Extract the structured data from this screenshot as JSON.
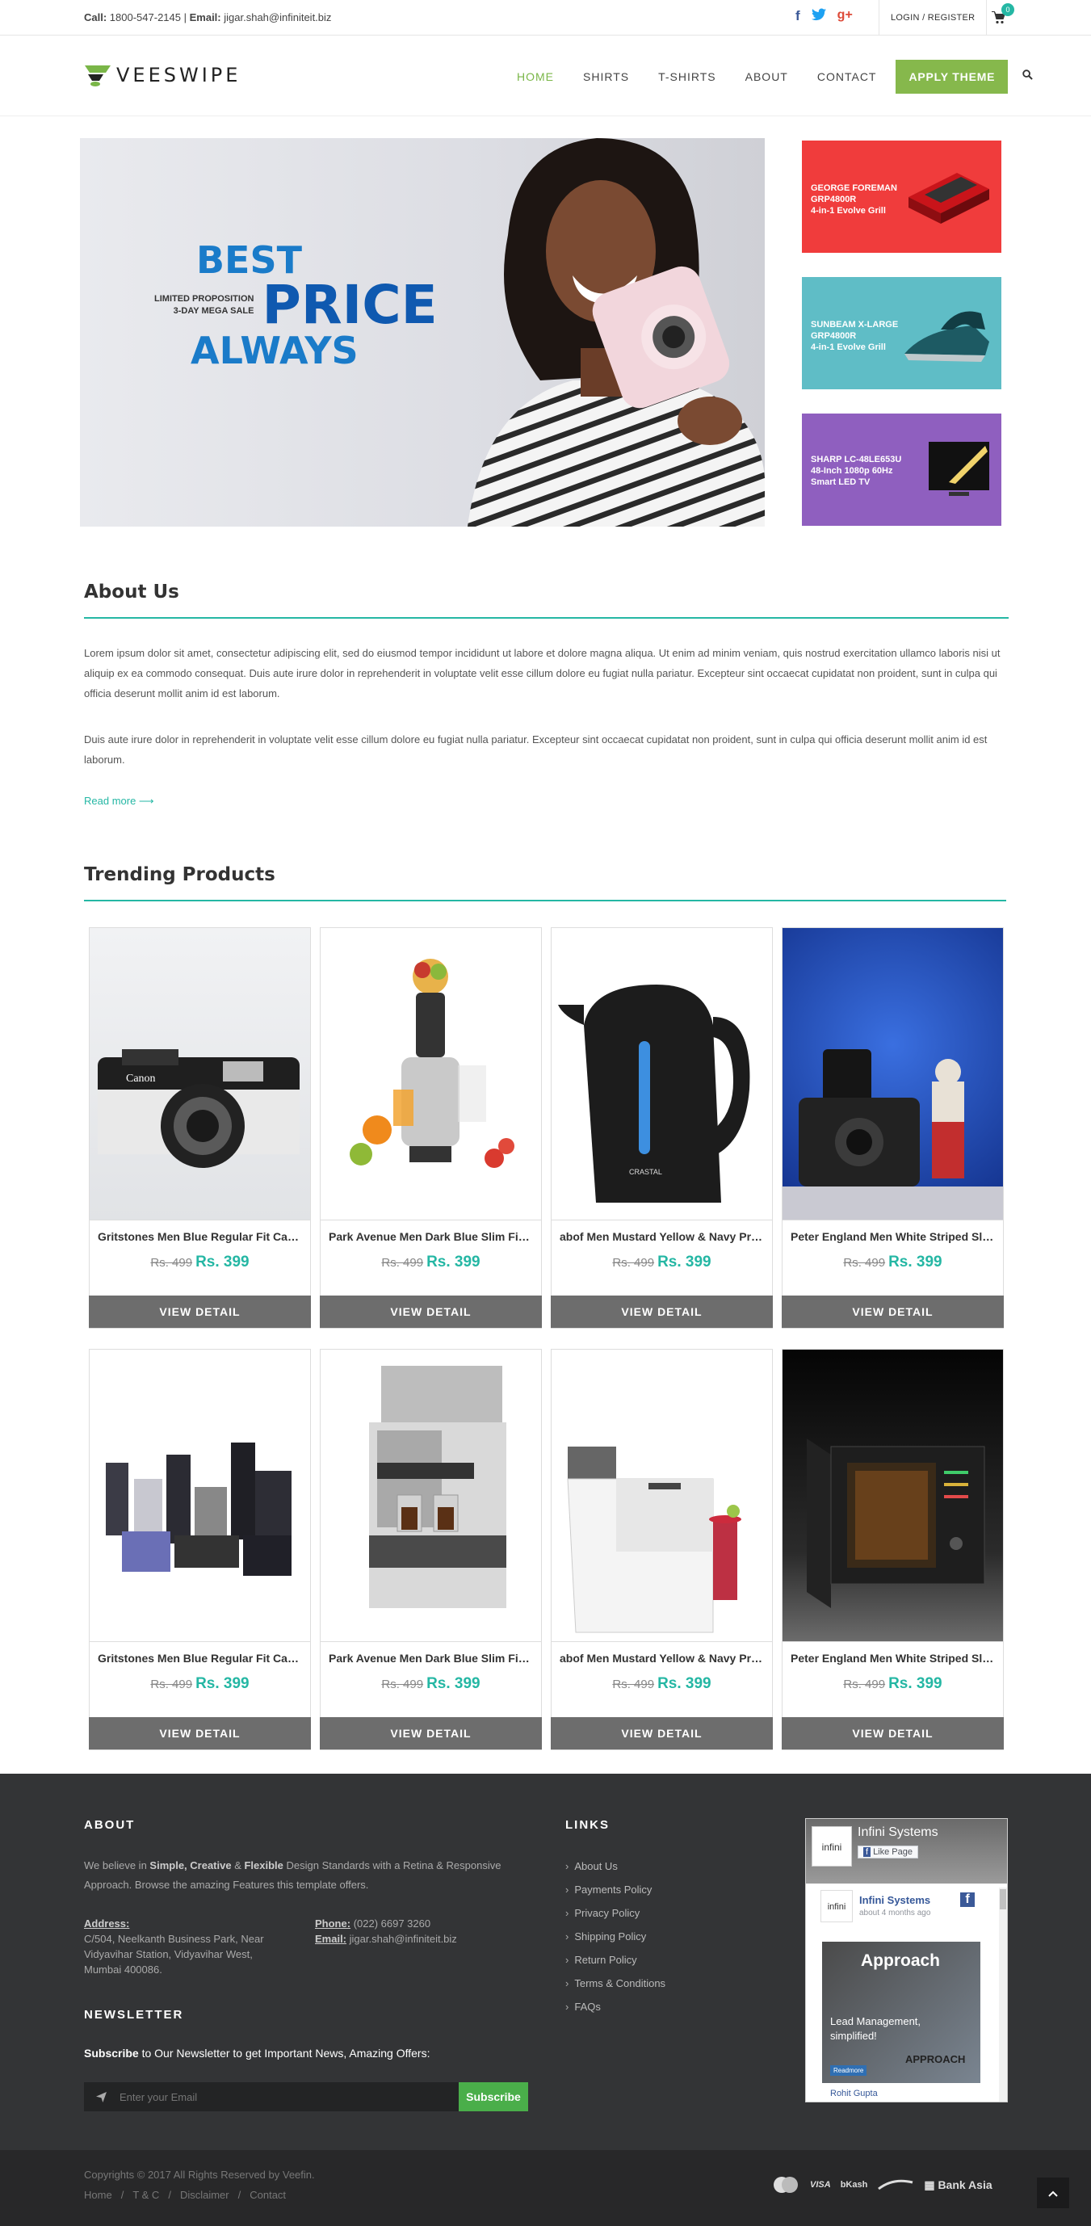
{
  "topbar": {
    "call_label": "Call:",
    "phone": "1800-547-2145",
    "email_label": "Email:",
    "email": "jigar.shah@infiniteit.biz",
    "login": "LOGIN / REGISTER",
    "cart_count": "0"
  },
  "brand": {
    "name": "VEESWIPE"
  },
  "nav": {
    "items": [
      "HOME",
      "SHIRTS",
      "T-SHIRTS",
      "ABOUT",
      "CONTACT"
    ],
    "apply_theme": "APPLY THEME"
  },
  "hero": {
    "line1": "BEST",
    "small1": "LIMITED PROPOSITION",
    "small2": "3-DAY MEGA SALE",
    "line2": "PRICE",
    "line3": "ALWAYS"
  },
  "promos": [
    {
      "l1": "GEORGE FOREMAN",
      "l2": "GRP4800R",
      "l3": "4-in-1 Evolve Grill",
      "color": "#f03c3c"
    },
    {
      "l1": "SUNBEAM X-LARGE",
      "l2": "GRP4800R",
      "l3": "4-in-1 Evolve Grill",
      "color": "#5fbdc6"
    },
    {
      "l1": "SHARP LC-48LE653U",
      "l2": "48-Inch 1080p 60Hz",
      "l3": "Smart LED TV",
      "color": "#8f5fbf"
    }
  ],
  "about": {
    "title": "About Us",
    "p1": "Lorem ipsum dolor sit amet, consectetur adipiscing elit, sed do eiusmod tempor incididunt ut labore et dolore magna aliqua. Ut enim ad minim veniam, quis nostrud exercitation ullamco laboris nisi ut aliquip ex ea commodo consequat. Duis aute irure dolor in reprehenderit in voluptate velit esse cillum dolore eu fugiat nulla pariatur. Excepteur sint occaecat cupidatat non proident, sunt in culpa qui officia deserunt mollit anim id est laborum.",
    "p2": "Duis aute irure dolor in reprehenderit in voluptate velit esse cillum dolore eu fugiat nulla pariatur. Excepteur sint occaecat cupidatat non proident, sunt in culpa qui officia deserunt mollit anim id est laborum.",
    "read_more": "Read more ⟶"
  },
  "trending": {
    "title": "Trending Products",
    "view_label": "VIEW DETAIL",
    "products": [
      {
        "name": "Gritstones Men Blue Regular Fit Casual Shirt",
        "old": "Rs. 499",
        "new": "Rs. 399"
      },
      {
        "name": "Park Avenue Men Dark Blue Slim Fit Formal",
        "old": "Rs. 499",
        "new": "Rs. 399"
      },
      {
        "name": "abof Men Mustard Yellow & Navy Printed",
        "old": "Rs. 499",
        "new": "Rs. 399"
      },
      {
        "name": "Peter England Men White Striped Slim Fit",
        "old": "Rs. 499",
        "new": "Rs. 399"
      },
      {
        "name": "Gritstones Men Blue Regular Fit Casual Shirt",
        "old": "Rs. 499",
        "new": "Rs. 399"
      },
      {
        "name": "Park Avenue Men Dark Blue Slim Fit Formal",
        "old": "Rs. 499",
        "new": "Rs. 399"
      },
      {
        "name": "abof Men Mustard Yellow & Navy Printed",
        "old": "Rs. 499",
        "new": "Rs. 399"
      },
      {
        "name": "Peter England Men White Striped Slim Fit",
        "old": "Rs. 499",
        "new": "Rs. 399"
      }
    ]
  },
  "footer": {
    "about_title": "ABOUT",
    "about_a": "We believe in ",
    "about_b": "Simple, Creative",
    "about_c": " & ",
    "about_d": "Flexible",
    "about_e": " Design Standards with a Retina & Responsive Approach. Browse the amazing Features this template offers.",
    "address_label": "Address:",
    "address": "C/504, Neelkanth Business Park, Near Vidyavihar Station, Vidyavihar West, Mumbai 400086.",
    "phone_label": "Phone:",
    "phone": "(022) 6697 3260",
    "email_label": "Email:",
    "email": "jigar.shah@infiniteit.biz",
    "newsletter_title": "NEWSLETTER",
    "newsletter_bold": "Subscribe",
    "newsletter_rest": " to Our Newsletter to get Important News, Amazing Offers:",
    "newsletter_placeholder": "Enter your Email",
    "subscribe": "Subscribe",
    "links_title": "LINKS",
    "links": [
      "About Us",
      "Payments Policy",
      "Privacy Policy",
      "Shipping Policy",
      "Return Policy",
      "Terms & Conditions",
      "FAQs"
    ],
    "fb": {
      "page_name": "Infini Systems",
      "like": "Like Page",
      "post_name": "Infini Systems",
      "post_time": "about 4 months ago",
      "post_title": "Approach",
      "post_sub1": "Lead Management,",
      "post_sub2": "simplified!",
      "post_tag": "APPROACH",
      "post_btn": "Readmore",
      "commenter": "Rohit Gupta"
    }
  },
  "bottom": {
    "copyright": "Copyrights © 2017 All Rights Reserved by Veefin.",
    "links": [
      "Home",
      "T & C",
      "Disclaimer",
      "Contact"
    ],
    "payments": [
      "VISA",
      "bKash",
      "Bank Asia"
    ]
  }
}
